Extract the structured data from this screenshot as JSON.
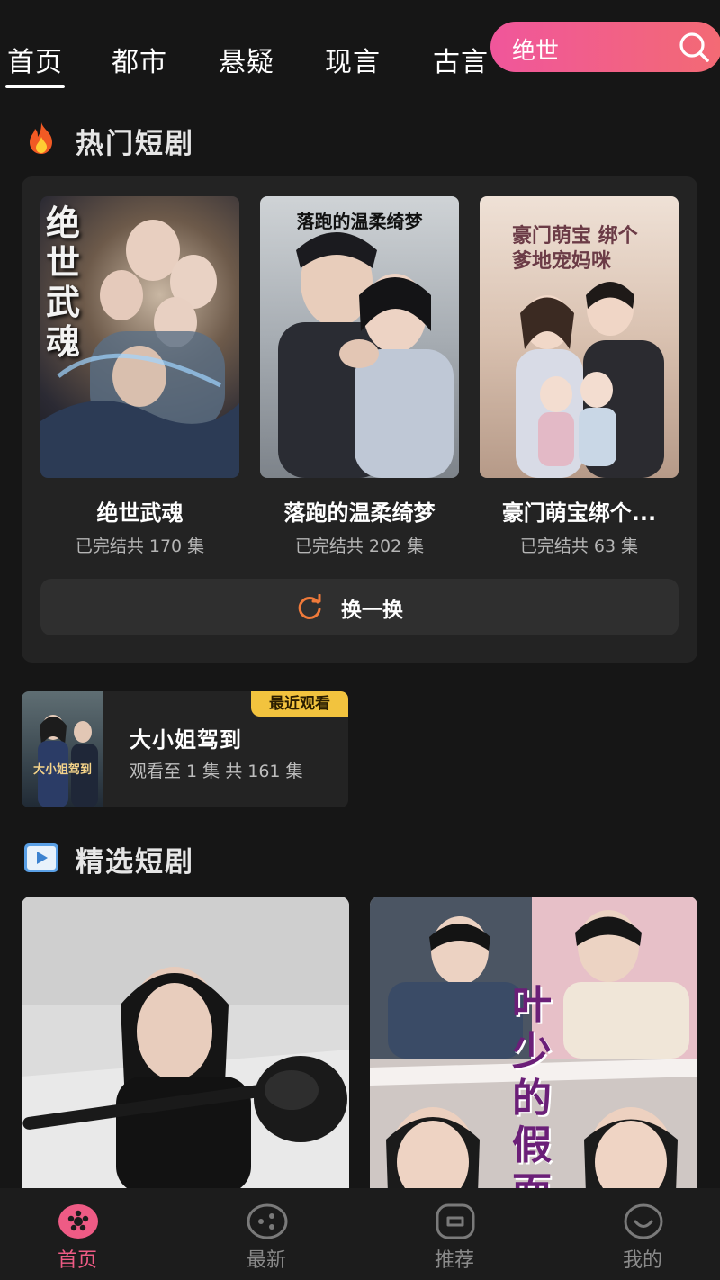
{
  "header": {
    "tabs": [
      {
        "label": "首页",
        "active": true
      },
      {
        "label": "都市",
        "active": false
      },
      {
        "label": "悬疑",
        "active": false
      },
      {
        "label": "现言",
        "active": false
      },
      {
        "label": "古言",
        "active": false
      }
    ],
    "search": {
      "placeholder": "绝世",
      "icon": "search-icon"
    }
  },
  "hot": {
    "title": "热门短剧",
    "icon": "fire-icon",
    "cards": [
      {
        "title": "绝世武魂",
        "subtitle": "已完结共 170 集",
        "poster_text": "绝世武魂"
      },
      {
        "title": "落跑的温柔绮梦",
        "subtitle": "已完结共 202 集",
        "poster_text": "落跑的温柔绮梦"
      },
      {
        "title": "豪门萌宝绑个...",
        "subtitle": "已完结共 63 集",
        "poster_text": "豪门萌宝 绑个爹地宠妈咪"
      }
    ],
    "refresh_label": "换一换"
  },
  "recent": {
    "badge": "最近观看",
    "title": "大小姐驾到",
    "subtitle": "观看至 1 集 共 161 集",
    "thumb_text": "大小姐驾到"
  },
  "featured": {
    "title": "精选短剧",
    "icon": "play-icon",
    "items": [
      {
        "poster_text": ""
      },
      {
        "poster_text": "叶少的假面"
      }
    ]
  },
  "bottom_nav": [
    {
      "label": "首页",
      "icon": "home-icon",
      "active": true
    },
    {
      "label": "最新",
      "icon": "latest-icon",
      "active": false
    },
    {
      "label": "推荐",
      "icon": "recommend-icon",
      "active": false
    },
    {
      "label": "我的",
      "icon": "profile-icon",
      "active": false
    }
  ],
  "colors": {
    "background": "#161616",
    "panel": "#232323",
    "accent_pink": "#ee5b85",
    "badge_yellow": "#f2c33e",
    "refresh_orange": "#f07a3a"
  }
}
